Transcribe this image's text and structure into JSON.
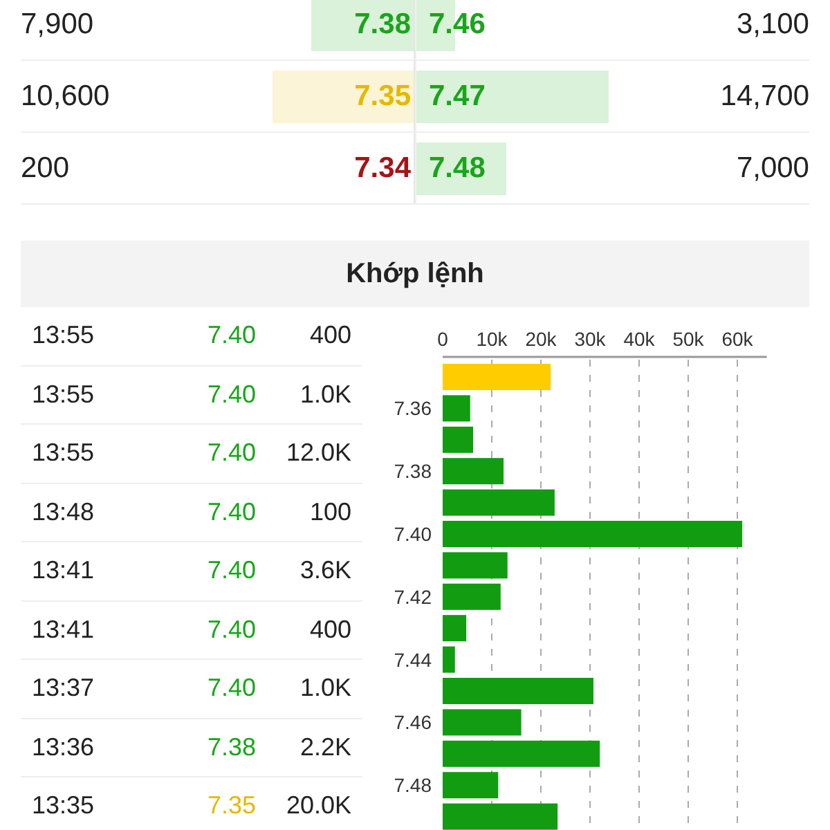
{
  "order_book": [
    {
      "bid": {
        "volume": "7,900",
        "price": "7.38",
        "color": "#1aa51a",
        "level": 0.26
      },
      "ask": {
        "price": "7.46",
        "color": "#1aa51a",
        "level": 0.1,
        "volume": "3,100"
      }
    },
    {
      "bid": {
        "volume": "10,600",
        "price": "7.35",
        "color": "#e6b800",
        "level": 0.36
      },
      "ask": {
        "price": "7.47",
        "color": "#1aa51a",
        "level": 0.49,
        "volume": "14,700"
      }
    },
    {
      "bid": {
        "volume": "200",
        "price": "7.34",
        "color": "#a31515"
      },
      "ask": {
        "price": "7.48",
        "color": "#1aa51a",
        "level": 0.23,
        "volume": "7,000"
      }
    }
  ],
  "matched_section": {
    "title": "Khớp lệnh",
    "trades": [
      {
        "time": "13:55",
        "price": "7.40",
        "color": "#1aa51a",
        "volume": "400"
      },
      {
        "time": "13:55",
        "price": "7.40",
        "color": "#1aa51a",
        "volume": "1.0K"
      },
      {
        "time": "13:55",
        "price": "7.40",
        "color": "#1aa51a",
        "volume": "12.0K"
      },
      {
        "time": "13:48",
        "price": "7.40",
        "color": "#1aa51a",
        "volume": "100"
      },
      {
        "time": "13:41",
        "price": "7.40",
        "color": "#1aa51a",
        "volume": "3.6K"
      },
      {
        "time": "13:41",
        "price": "7.40",
        "color": "#1aa51a",
        "volume": "400"
      },
      {
        "time": "13:37",
        "price": "7.40",
        "color": "#1aa51a",
        "volume": "1.0K"
      },
      {
        "time": "13:36",
        "price": "7.38",
        "color": "#1aa51a",
        "volume": "2.2K"
      },
      {
        "time": "13:35",
        "price": "7.35",
        "color": "#e6b800",
        "volume": "20.0K"
      }
    ],
    "chart_data": {
      "type": "bar",
      "orientation": "horizontal",
      "grid": true,
      "x": [
        7.35,
        7.36,
        7.37,
        7.38,
        7.39,
        7.4,
        7.41,
        7.42,
        7.43,
        7.44,
        7.45,
        7.46,
        7.47,
        7.48,
        7.49
      ],
      "series": [
        {
          "color": "#ffcc00",
          "values": [
            22000,
            null,
            null,
            null,
            null,
            null,
            null,
            null,
            null,
            null,
            null,
            null,
            null,
            null,
            null
          ]
        },
        {
          "color": "#119c11",
          "values": [
            null,
            5600,
            6200,
            12400,
            22800,
            61000,
            13200,
            11800,
            4800,
            2500,
            30700,
            16000,
            32000,
            11300,
            23400
          ]
        }
      ],
      "xlim": [
        0,
        66000
      ],
      "ylim": [
        7.495,
        7.345
      ],
      "xticks": [
        {
          "value": 0,
          "label": "0"
        },
        {
          "value": 10000,
          "label": "10k"
        },
        {
          "value": 20000,
          "label": "20k"
        },
        {
          "value": 30000,
          "label": "30k"
        },
        {
          "value": 40000,
          "label": "40k"
        },
        {
          "value": 50000,
          "label": "50k"
        },
        {
          "value": 60000,
          "label": "60k"
        }
      ],
      "yticks": [
        {
          "value": 7.36,
          "label": "7.36"
        },
        {
          "value": 7.38,
          "label": "7.38"
        },
        {
          "value": 7.4,
          "label": "7.40"
        },
        {
          "value": 7.42,
          "label": "7.42"
        },
        {
          "value": 7.44,
          "label": "7.44"
        },
        {
          "value": 7.46,
          "label": "7.46"
        },
        {
          "value": 7.48,
          "label": "7.48"
        }
      ]
    }
  }
}
